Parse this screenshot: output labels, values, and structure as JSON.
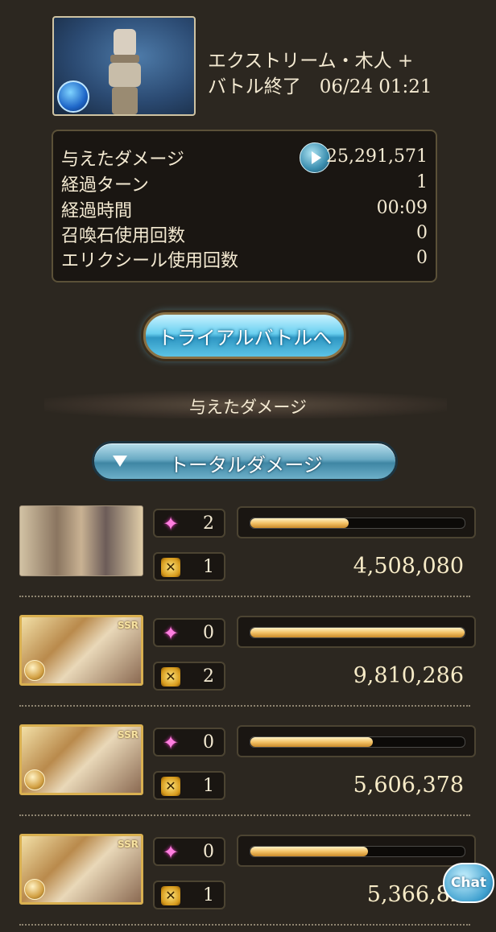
{
  "quest": {
    "title": "エクストリーム・木人 +",
    "end_line": "バトル終了　06/24 01:21",
    "element_icon": "water-element-icon"
  },
  "stats": [
    {
      "label": "与えたダメージ",
      "value": "25,291,571"
    },
    {
      "label": "経過ターン",
      "value": "1"
    },
    {
      "label": "経過時間",
      "value": "00:09"
    },
    {
      "label": "召喚石使用回数",
      "value": "0"
    },
    {
      "label": "エリクシール使用回数",
      "value": "0"
    }
  ],
  "trial_button": {
    "label": "トライアルバトルへ"
  },
  "section": {
    "title": "与えたダメージ"
  },
  "dropdown": {
    "label": "トータルダメージ"
  },
  "characters": [
    {
      "ougi_count": "2",
      "turn_count": "1",
      "damage": "4,508,080",
      "share": 0.46,
      "ssr": false
    },
    {
      "ougi_count": "0",
      "turn_count": "2",
      "damage": "9,810,286",
      "share": 1.0,
      "ssr": true,
      "ssr_label": "SSR"
    },
    {
      "ougi_count": "0",
      "turn_count": "1",
      "damage": "5,606,378",
      "share": 0.57,
      "ssr": true,
      "ssr_label": "SSR"
    },
    {
      "ougi_count": "0",
      "turn_count": "1",
      "damage": "5,366,82",
      "share": 0.55,
      "ssr": true,
      "ssr_label": "SSR"
    }
  ],
  "chat": {
    "label": "Chat"
  },
  "colors": {
    "background": "#2c2720",
    "text": "#f4ead2",
    "bar_fill": "#f3c266",
    "accent_blue": "#3f86a4"
  }
}
